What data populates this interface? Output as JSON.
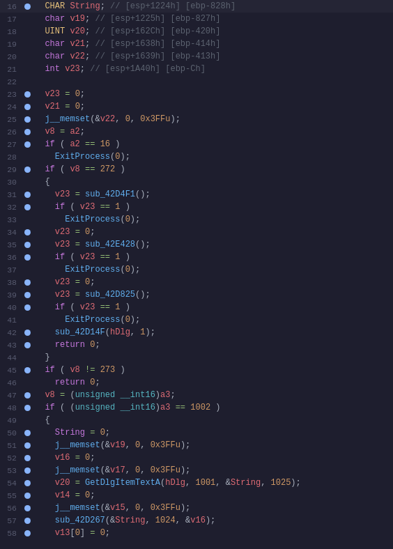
{
  "lines": [
    {
      "num": 16,
      "bp": true,
      "content": "  <type>CHAR</type> <var>String</var><punc>;</punc> <cm>// [esp+1224h] [ebp-828h]</cm>"
    },
    {
      "num": 17,
      "bp": false,
      "content": "  <kw>char</kw> <var>v19</var><punc>;</punc> <cm>// [esp+1225h] [ebp-827h]</cm>"
    },
    {
      "num": 18,
      "bp": false,
      "content": "  <type>UINT</type> <var>v20</var><punc>;</punc> <cm>// [esp+162Ch] [ebp-420h]</cm>"
    },
    {
      "num": 19,
      "bp": false,
      "content": "  <kw>char</kw> <var>v21</var><punc>;</punc> <cm>// [esp+1638h] [ebp-414h]</cm>"
    },
    {
      "num": 20,
      "bp": false,
      "content": "  <kw>char</kw> <var>v22</var><punc>;</punc> <cm>// [esp+1639h] [ebp-413h]</cm>"
    },
    {
      "num": 21,
      "bp": false,
      "content": "  <kw>int</kw> <var>v23</var><punc>;</punc> <cm>// [esp+1A40h] [ebp-Ch]</cm>"
    },
    {
      "num": 22,
      "bp": false,
      "content": ""
    },
    {
      "num": 23,
      "bp": true,
      "content": "  <var>v23</var> <op>=</op> <num>0</num><punc>;</punc>"
    },
    {
      "num": 24,
      "bp": true,
      "content": "  <var>v21</var> <op>=</op> <num>0</num><punc>;</punc>"
    },
    {
      "num": 25,
      "bp": true,
      "content": "  <fn>j__memset</fn><punc>(&amp;</punc><var>v22</var><punc>,</punc> <num>0</num><punc>,</punc> <num>0x3FFu</num><punc>);</punc>"
    },
    {
      "num": 26,
      "bp": true,
      "content": "  <var>v8</var> <op>=</op> <var>a2</var><punc>;</punc>"
    },
    {
      "num": 27,
      "bp": true,
      "content": "  <kw>if</kw> <punc>(</punc> <var>a2</var> <op>==</op> <num>16</num> <punc>)</punc>"
    },
    {
      "num": 28,
      "bp": false,
      "content": "    <fn>ExitProcess</fn><punc>(</punc><num>0</num><punc>);</punc>"
    },
    {
      "num": 29,
      "bp": true,
      "content": "  <kw>if</kw> <punc>(</punc> <var>v8</var> <op>==</op> <num>272</num> <punc>)</punc>"
    },
    {
      "num": 30,
      "bp": false,
      "content": "  <punc>{</punc>"
    },
    {
      "num": 31,
      "bp": true,
      "content": "    <var>v23</var> <op>=</op> <fn>sub_42D4F1</fn><punc>();</punc>"
    },
    {
      "num": 32,
      "bp": true,
      "content": "    <kw>if</kw> <punc>(</punc> <var>v23</var> <op>==</op> <num>1</num> <punc>)</punc>"
    },
    {
      "num": 33,
      "bp": false,
      "content": "      <fn>ExitProcess</fn><punc>(</punc><num>0</num><punc>);</punc>"
    },
    {
      "num": 34,
      "bp": true,
      "content": "    <var>v23</var> <op>=</op> <num>0</num><punc>;</punc>"
    },
    {
      "num": 35,
      "bp": true,
      "content": "    <var>v23</var> <op>=</op> <fn>sub_42E428</fn><punc>();</punc>"
    },
    {
      "num": 36,
      "bp": true,
      "content": "    <kw>if</kw> <punc>(</punc> <var>v23</var> <op>==</op> <num>1</num> <punc>)</punc>"
    },
    {
      "num": 37,
      "bp": false,
      "content": "      <fn>ExitProcess</fn><punc>(</punc><num>0</num><punc>);</punc>"
    },
    {
      "num": 38,
      "bp": true,
      "content": "    <var>v23</var> <op>=</op> <num>0</num><punc>;</punc>"
    },
    {
      "num": 39,
      "bp": true,
      "content": "    <var>v23</var> <op>=</op> <fn>sub_42D825</fn><punc>();</punc>"
    },
    {
      "num": 40,
      "bp": true,
      "content": "    <kw>if</kw> <punc>(</punc> <var>v23</var> <op>==</op> <num>1</num> <punc>)</punc>"
    },
    {
      "num": 41,
      "bp": false,
      "content": "      <fn>ExitProcess</fn><punc>(</punc><num>0</num><punc>);</punc>"
    },
    {
      "num": 42,
      "bp": true,
      "content": "    <fn>sub_42D14F</fn><punc>(</punc><var>hDlg</var><punc>,</punc> <num>1</num><punc>);</punc>"
    },
    {
      "num": 43,
      "bp": true,
      "content": "    <kw>return</kw> <num>0</num><punc>;</punc>"
    },
    {
      "num": 44,
      "bp": false,
      "content": "  <punc>}</punc>"
    },
    {
      "num": 45,
      "bp": true,
      "content": "  <kw>if</kw> <punc>(</punc> <var>v8</var> <op>!=</op> <num>273</num> <punc>)</punc>"
    },
    {
      "num": 46,
      "bp": false,
      "content": "    <kw>return</kw> <num>0</num><punc>;</punc>"
    },
    {
      "num": 47,
      "bp": true,
      "content": "  <var>v8</var> <op>=</op> <punc>(</punc><kw2>unsigned</kw2> <kw2>__int16</kw2><punc>)</punc><var>a3</var><punc>;</punc>"
    },
    {
      "num": 48,
      "bp": true,
      "content": "  <kw>if</kw> <punc>(</punc> <punc>(</punc><kw2>unsigned</kw2> <kw2>__int16</kw2><punc>)</punc><var>a3</var> <op>==</op> <num>1002</num> <punc>)</punc>"
    },
    {
      "num": 49,
      "bp": false,
      "content": "  <punc>{</punc>"
    },
    {
      "num": 50,
      "bp": true,
      "content": "    <kw>String</kw> <op>=</op> <num>0</num><punc>;</punc>"
    },
    {
      "num": 51,
      "bp": true,
      "content": "    <fn>j__memset</fn><punc>(&amp;</punc><var>v19</var><punc>,</punc> <num>0</num><punc>,</punc> <num>0x3FFu</num><punc>);</punc>"
    },
    {
      "num": 52,
      "bp": true,
      "content": "    <var>v16</var> <op>=</op> <num>0</num><punc>;</punc>"
    },
    {
      "num": 53,
      "bp": true,
      "content": "    <fn>j__memset</fn><punc>(&amp;</punc><var>v17</var><punc>,</punc> <num>0</num><punc>,</punc> <num>0x3FFu</num><punc>);</punc>"
    },
    {
      "num": 54,
      "bp": true,
      "content": "    <var>v20</var> <op>=</op> <fn>GetDlgItemTextA</fn><punc>(</punc><var>hDlg</var><punc>,</punc> <num>1001</num><punc>,</punc> <punc>&amp;</punc><var>String</var><punc>,</punc> <num>1025</num><punc>);</punc>"
    },
    {
      "num": 55,
      "bp": true,
      "content": "    <var>v14</var> <op>=</op> <num>0</num><punc>;</punc>"
    },
    {
      "num": 56,
      "bp": true,
      "content": "    <fn>j__memset</fn><punc>(&amp;</punc><var>v15</var><punc>,</punc> <num>0</num><punc>,</punc> <num>0x3FFu</num><punc>);</punc>"
    },
    {
      "num": 57,
      "bp": true,
      "content": "    <fn>sub_42D267</fn><punc>(&amp;</punc><var>String</var><punc>,</punc> <num>1024</num><punc>,</punc> <punc>&amp;</punc><var>v16</var><punc>);</punc>"
    },
    {
      "num": 58,
      "bp": true,
      "content": "    <var>v13</var><punc>[</punc><num>0</num><punc>]</punc> <op>=</op> <num>0</num><punc>;</punc>"
    }
  ]
}
